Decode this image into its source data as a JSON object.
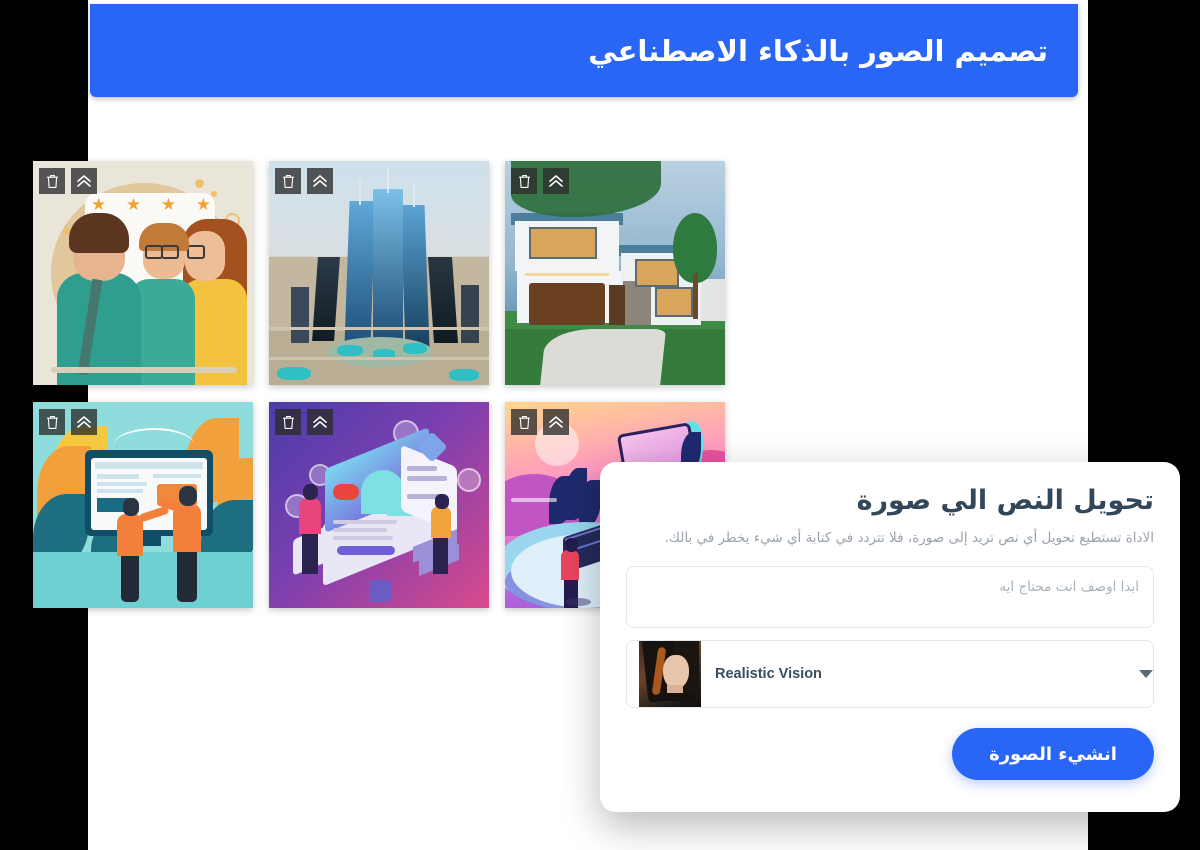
{
  "header": {
    "title": "تصميم الصور بالذكاء الاصطناعي",
    "bg_color": "#2a66f5"
  },
  "gallery": {
    "card_tools": {
      "delete_icon": "trash-icon",
      "collapse_icon": "double-chevron-up-icon"
    },
    "items": [
      {
        "id": "card-1",
        "alt": "رسم توضيحي لثلاثة أشخاص مع تقييم أربع نجوم",
        "style": "people-rating",
        "stars": 4
      },
      {
        "id": "card-2",
        "alt": "أبراج زجاجية حديثة في مدينة صحراوية",
        "style": "towers"
      },
      {
        "id": "card-3",
        "alt": "منزل عصري من طابقين عند الغروب",
        "style": "house"
      },
      {
        "id": "card-4",
        "alt": "شخصان أمام شاشة كبيرة بخلفية أوراق برتقالية",
        "style": "workspace"
      },
      {
        "id": "card-5",
        "alt": "رسم أيزومتري بنفسجي لواجهة تطبيق",
        "style": "isometric"
      },
      {
        "id": "card-6",
        "alt": "مشهد غروب مع ألواح شمسية",
        "style": "solar"
      }
    ]
  },
  "dialog": {
    "title": "تحويل النص الي صورة",
    "subtitle": "الاداة تستطيع تحويل أي نص تريد إلى صورة، فلا تتردد في كتابة أي شيء يخطر في بالك.",
    "prompt": {
      "placeholder": "ابدا اوصف انت محتاج ايه",
      "value": ""
    },
    "model_select": {
      "selected": "Realistic Vision",
      "caret_icon": "chevron-down-icon",
      "thumbnail_alt": "صورة مصغرة لنموذج Realistic Vision"
    },
    "submit_label": "انشيء الصورة",
    "accent_color": "#2a66f5"
  }
}
